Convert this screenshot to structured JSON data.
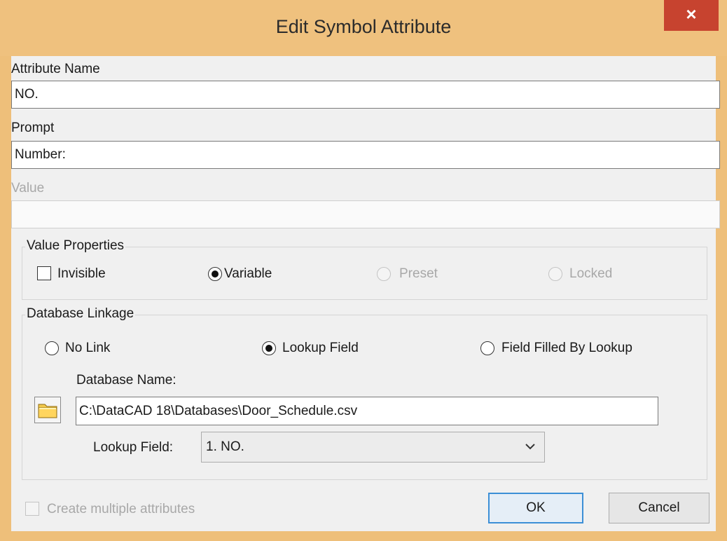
{
  "window": {
    "title": "Edit Symbol Attribute",
    "close_label": "×"
  },
  "attribute_name": {
    "label": "Attribute Name",
    "value": "NO."
  },
  "prompt": {
    "label": "Prompt",
    "value": "Number:"
  },
  "value": {
    "label": "Value",
    "value": ""
  },
  "value_properties": {
    "title": "Value Properties",
    "invisible": "Invisible",
    "variable": "Variable",
    "preset": "Preset",
    "locked": "Locked"
  },
  "database_linkage": {
    "title": "Database Linkage",
    "no_link": "No Link",
    "lookup_field_option": "Lookup Field",
    "field_filled": "Field Filled By Lookup",
    "db_name_label": "Database Name:",
    "db_name_value": "C:\\DataCAD 18\\Databases\\Door_Schedule.csv",
    "lookup_field_label": "Lookup Field:",
    "lookup_field_value": "1. NO."
  },
  "footer": {
    "multiple_label": "Create multiple attributes",
    "ok_label": "OK",
    "cancel_label": "Cancel"
  },
  "icons": {
    "folder": "folder-open-icon",
    "close": "close-icon",
    "chevron": "chevron-down-icon"
  },
  "colors": {
    "frame": "#efc17e",
    "close": "#c7432f",
    "accent": "#3c8fd6"
  }
}
